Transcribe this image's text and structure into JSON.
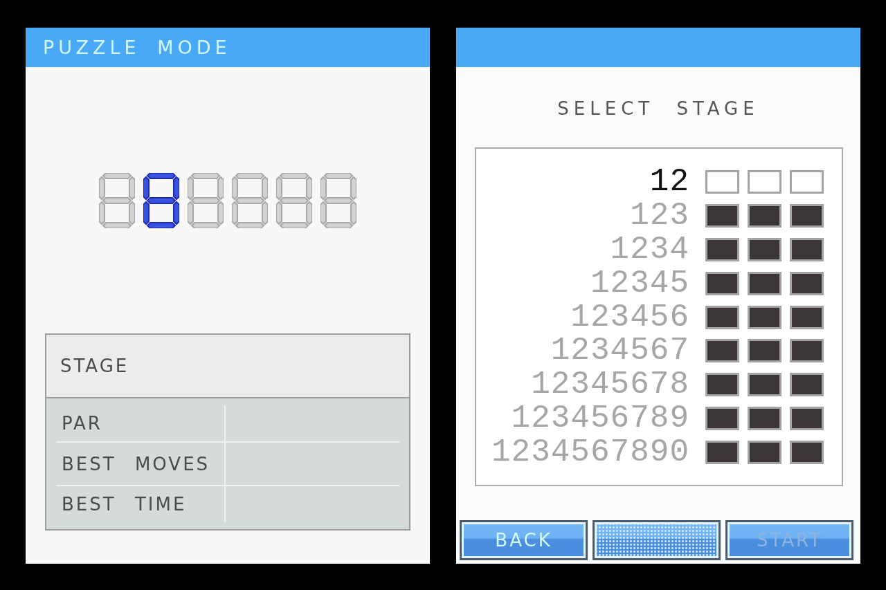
{
  "puzzle_mode": {
    "title": "PUZZLE MODE",
    "code_display": {
      "digits": [
        {
          "selected": false
        },
        {
          "selected": true
        },
        {
          "selected": false
        },
        {
          "selected": false
        },
        {
          "selected": false
        },
        {
          "selected": false
        }
      ]
    },
    "info_table": {
      "header": "STAGE",
      "rows": [
        {
          "label": "PAR"
        },
        {
          "label": "BEST MOVES"
        },
        {
          "label": "BEST TIME"
        }
      ]
    }
  },
  "stage_select": {
    "heading": "SELECT STAGE",
    "stages": [
      {
        "number": "12",
        "selected": true,
        "slots": [
          {
            "filled": false
          },
          {
            "filled": false
          },
          {
            "filled": false
          }
        ]
      },
      {
        "number": "123",
        "selected": false,
        "slots": [
          {
            "filled": true
          },
          {
            "filled": true
          },
          {
            "filled": true
          }
        ]
      },
      {
        "number": "1234",
        "selected": false,
        "slots": [
          {
            "filled": true
          },
          {
            "filled": true
          },
          {
            "filled": true
          }
        ]
      },
      {
        "number": "12345",
        "selected": false,
        "slots": [
          {
            "filled": true
          },
          {
            "filled": true
          },
          {
            "filled": true
          }
        ]
      },
      {
        "number": "123456",
        "selected": false,
        "slots": [
          {
            "filled": true
          },
          {
            "filled": true
          },
          {
            "filled": true
          }
        ]
      },
      {
        "number": "1234567",
        "selected": false,
        "slots": [
          {
            "filled": true
          },
          {
            "filled": true
          },
          {
            "filled": true
          }
        ]
      },
      {
        "number": "12345678",
        "selected": false,
        "slots": [
          {
            "filled": true
          },
          {
            "filled": true
          },
          {
            "filled": true
          }
        ]
      },
      {
        "number": "123456789",
        "selected": false,
        "slots": [
          {
            "filled": true
          },
          {
            "filled": true
          },
          {
            "filled": true
          }
        ]
      },
      {
        "number": "1234567890",
        "selected": false,
        "slots": [
          {
            "filled": true
          },
          {
            "filled": true
          },
          {
            "filled": true
          }
        ]
      }
    ],
    "buttons": [
      {
        "kind": "text",
        "label": "BACK",
        "disabled": false
      },
      {
        "kind": "pattern",
        "disabled": false
      },
      {
        "kind": "text",
        "label": "START",
        "disabled": true
      }
    ]
  }
}
